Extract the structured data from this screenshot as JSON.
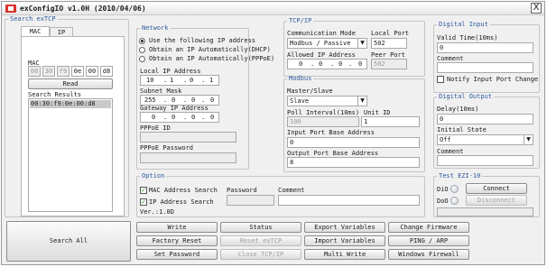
{
  "window": {
    "title": "exConfigIO v1.0H (2010/04/06)",
    "close_label": "X"
  },
  "search_group": {
    "legend": "Search exTCP",
    "tabs": [
      "MAC",
      "IP"
    ],
    "mac_label": "MAC",
    "mac_octets": [
      "00",
      "30",
      "f9",
      "0e",
      "00",
      "d8"
    ],
    "read_label": "Read",
    "results_label": "Search Results",
    "results": [
      "00:30:f9:0e:00:d8"
    ]
  },
  "network": {
    "legend": "Network",
    "radio_options": [
      "Use the following IP address",
      "Obtain an IP Automatically(DHCP)",
      "Obtain an IP Automatically(PPPoE)"
    ],
    "selected_index": 0,
    "local_ip_label": "Local IP Address",
    "local_ip": [
      "10",
      "1",
      "0",
      "1"
    ],
    "subnet_label": "Subnet Mask",
    "subnet": [
      "255",
      "0",
      "0",
      "0"
    ],
    "gateway_label": "Gateway IP Address",
    "gateway": [
      "0",
      "0",
      "0",
      "0"
    ],
    "pppoe_id_label": "PPPoE ID",
    "pppoe_pw_label": "PPPoE Password"
  },
  "tcpip": {
    "legend": "TCP/IP",
    "comm_mode_label": "Communication Mode",
    "comm_mode_value": "Modbus / Passive",
    "local_port_label": "Local Port",
    "local_port": "502",
    "allowed_ip_label": "Allowed IP Address",
    "allowed_ip": [
      "0",
      "0",
      "0",
      "0"
    ],
    "peer_port_label": "Peer Port",
    "peer_port": "502"
  },
  "modbus": {
    "legend": "Modbus",
    "master_slave_label": "Master/Slave",
    "master_slave_value": "Slave",
    "poll_label": "Poll Interval(10ms)",
    "poll_value": "100",
    "unit_id_label": "Unit ID",
    "unit_id_value": "1",
    "input_base_label": "Input Port Base Address",
    "input_base_value": "0",
    "output_base_label": "Output Port Base Address",
    "output_base_value": "8"
  },
  "digital_input": {
    "legend": "Digital Input",
    "valid_time_label": "Valid Time(10ms)",
    "valid_time_value": "0",
    "comment_label": "Comment",
    "notify_label": "Notify Input Port Change"
  },
  "digital_output": {
    "legend": "Digital Output",
    "delay_label": "Delay(10ms)",
    "delay_value": "0",
    "initial_label": "Initial State",
    "initial_value": "Off",
    "comment_label": "Comment"
  },
  "option": {
    "legend": "Option",
    "mac_search_label": "MAC Address Search",
    "ip_search_label": "IP Address Search",
    "password_label": "Password",
    "comment_label": "Comment",
    "version": "Ver.:1.0D"
  },
  "test": {
    "legend": "Test EZI-10",
    "di_label": "DiO",
    "do_label": "DoO",
    "connect_label": "Connect",
    "disconnect_label": "Disconnect"
  },
  "buttons": {
    "search_all": "Search All",
    "write": "Write",
    "status": "Status",
    "export": "Export Variables",
    "change_fw": "Change Firmware",
    "factory_reset": "Factory Reset",
    "reset_extcp": "Reset exTCP",
    "import": "Import Variables",
    "ping_arp": "PING / ARP",
    "set_password": "Set Password",
    "close_tcpip": "Close TCP/IP",
    "multi_write": "Multi Write",
    "windows_firewall": "Windows Firewall"
  },
  "icons": {
    "app": "app-icon",
    "close": "close-icon",
    "dropdown": "chevron-down-icon",
    "check": "checkmark-icon"
  }
}
